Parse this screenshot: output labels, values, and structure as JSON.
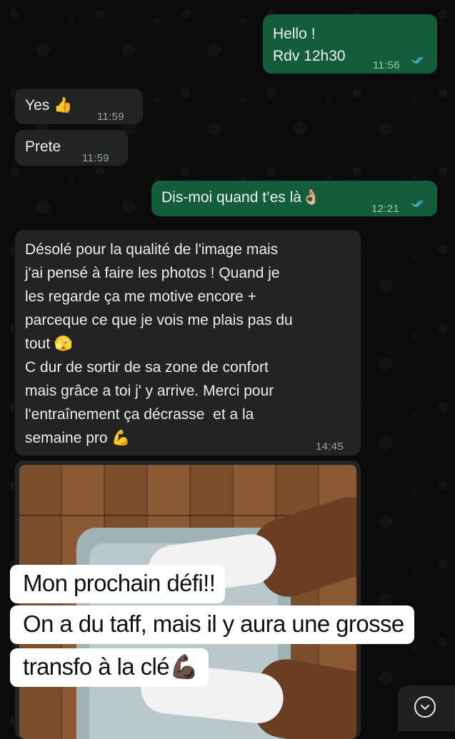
{
  "messages": [
    {
      "id": "m1",
      "direction": "outgoing",
      "lines": [
        "Hello !",
        "Rdv 12h30"
      ],
      "time": "11:56",
      "read": true
    },
    {
      "id": "m2",
      "direction": "incoming",
      "text": "Yes 👍",
      "time": "11:59"
    },
    {
      "id": "m3",
      "direction": "incoming",
      "text": "Prete",
      "time": "11:59"
    },
    {
      "id": "m4",
      "direction": "outgoing",
      "text": "Dis-moi quand t’es là👌🏼",
      "time": "12:21",
      "read": true
    },
    {
      "id": "m5",
      "direction": "incoming",
      "lines": [
        "Désolé pour la qualité de l'image mais",
        "j'ai pensé à faire les photos ! Quand je",
        "les regarde ça me motive encore +",
        "parceque ce que je vois me plais pas du",
        "tout 🫣",
        "C dur de sortir de sa zone de confort",
        "mais grâce a toi j' y arrive. Merci pour",
        "l'entraînement ça décrasse  et a la",
        "semaine pro 💪"
      ],
      "time": "14:45"
    }
  ],
  "overlay_caption": {
    "line1": "Mon prochain défi!!",
    "line2": "On a du taff, mais il y aura une grosse",
    "line3": "transfo à la clé💪🏿"
  },
  "icons": {
    "read_ticks": "double-check-icon",
    "scroll_down": "chevron-down-icon"
  },
  "colors": {
    "outgoing_bubble": "#135c3c",
    "incoming_bubble": "#222424",
    "read_tick": "#53bdeb"
  }
}
